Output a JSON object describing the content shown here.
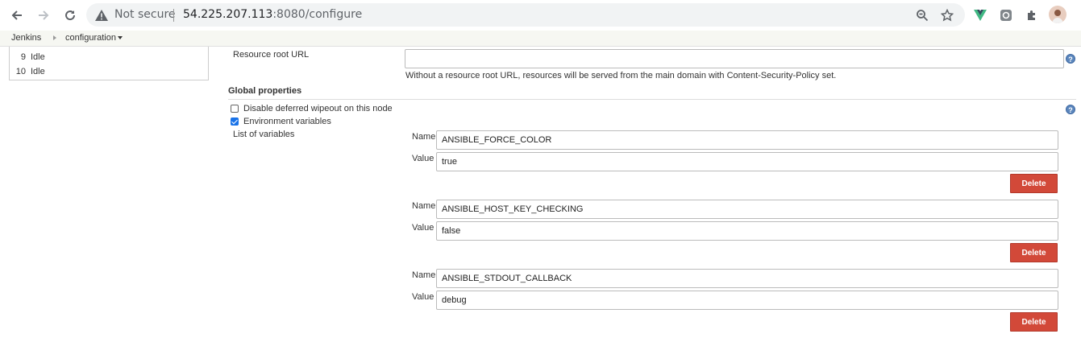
{
  "browser": {
    "security_label": "Not secure",
    "url_host": "54.225.207.113",
    "url_rest": ":8080/configure"
  },
  "breadcrumb": {
    "items": [
      "Jenkins",
      "configuration"
    ]
  },
  "executors": [
    {
      "number": "9",
      "status": "Idle"
    },
    {
      "number": "10",
      "status": "Idle"
    }
  ],
  "resource_root": {
    "label": "Resource root URL",
    "value": "",
    "description": "Without a resource root URL, resources will be served from the main domain with Content-Security-Policy set."
  },
  "global_properties": {
    "heading": "Global properties",
    "disable_wipeout_label": "Disable deferred wipeout on this node",
    "disable_wipeout_checked": false,
    "env_vars_label": "Environment variables",
    "env_vars_checked": true,
    "list_label": "List of variables"
  },
  "variables": [
    {
      "name_label": "Name",
      "value_label": "Value",
      "name": "ANSIBLE_FORCE_COLOR",
      "value": "true",
      "delete_label": "Delete"
    },
    {
      "name_label": "Name",
      "value_label": "Value",
      "name": "ANSIBLE_HOST_KEY_CHECKING",
      "value": "false",
      "delete_label": "Delete"
    },
    {
      "name_label": "Name",
      "value_label": "Value",
      "name": "ANSIBLE_STDOUT_CALLBACK",
      "value": "debug",
      "delete_label": "Delete"
    }
  ],
  "help_glyph": "?",
  "colors": {
    "delete_button": "#d24939",
    "help_icon": "#5c87bd",
    "checkbox_checked": "#1a73e8"
  }
}
